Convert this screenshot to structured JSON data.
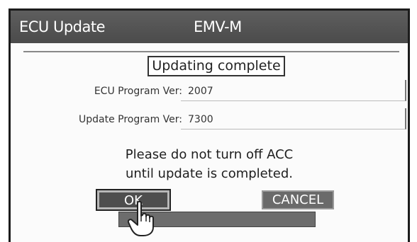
{
  "window": {
    "title": "ECU Update",
    "model": "EMV-M"
  },
  "status": "Updating complete",
  "rows": [
    {
      "label": "ECU Program Ver:",
      "value": "2007"
    },
    {
      "label": "Update Program Ver:",
      "value": "7300"
    }
  ],
  "message": {
    "line1": "Please do not turn off ACC",
    "line2": "until update is completed."
  },
  "buttons": {
    "ok": "OK",
    "cancel": "CANCEL"
  },
  "progress": {
    "fraction": 1.0
  },
  "icons": {
    "pointer": "hand-pointer-icon"
  },
  "colors": {
    "titlebar": "#555555",
    "button": "#4e4e4e"
  }
}
